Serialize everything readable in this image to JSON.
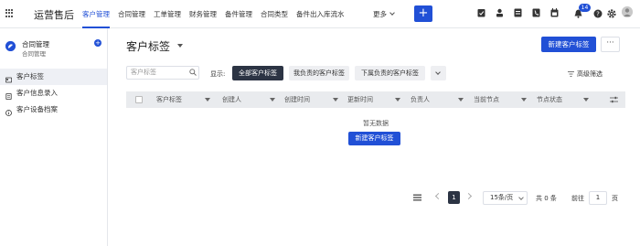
{
  "app": {
    "title": "运营售后"
  },
  "nav": {
    "items": [
      "客户管理",
      "合同管理",
      "工单管理",
      "财务管理",
      "备件管理",
      "合同类型",
      "备件出入库流水"
    ],
    "active_index": 0,
    "more_label": "更多",
    "notification_count": "14"
  },
  "sidebar": {
    "title": "合同管理",
    "subtitle": "合同管理",
    "items": [
      {
        "label": "客户标签",
        "icon": "card-icon"
      },
      {
        "label": "客户信息录入",
        "icon": "document-icon"
      },
      {
        "label": "客户设备档案",
        "icon": "info-icon"
      }
    ]
  },
  "main": {
    "page_title": "客户标签",
    "new_button": "新建客户标签",
    "more_button": "···",
    "search_placeholder": "客户标签",
    "show_label": "显示:",
    "filters": [
      "全部客户标签",
      "我负责的客户标签",
      "下属负责的客户标签"
    ],
    "active_filter": 0,
    "advanced_filter": "高级筛选",
    "columns": [
      "客户标签",
      "创建人",
      "创建时间",
      "更新时间",
      "负责人",
      "当前节点",
      "节点状态"
    ],
    "empty_text": "暂无数据",
    "empty_new_button": "新建客户标签"
  },
  "pagination": {
    "current_page": "1",
    "page_size": "15条/页",
    "total": "共 0 条",
    "goto_label": "前往",
    "goto_value": "1",
    "page_suffix": "页"
  },
  "colors": {
    "primary": "#2150d6",
    "dark": "#2c3444"
  }
}
